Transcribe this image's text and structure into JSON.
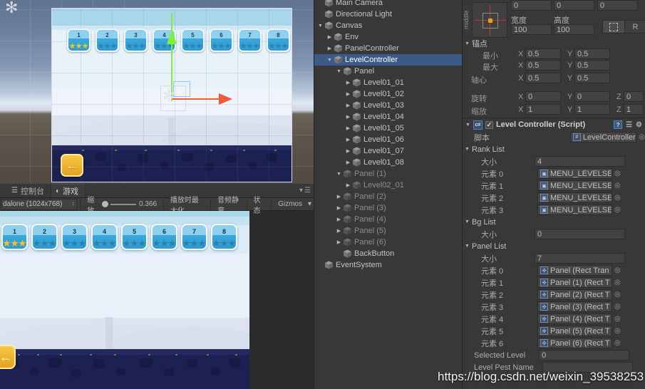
{
  "scene": {
    "levels": [
      {
        "num": "1",
        "stars": [
          "gold",
          "gold",
          "gold"
        ]
      },
      {
        "num": "2",
        "stars": [
          "blue",
          "blue",
          "blue"
        ]
      },
      {
        "num": "3",
        "stars": [
          "blue",
          "blue",
          "blue"
        ]
      },
      {
        "num": "4",
        "stars": [
          "blue",
          "blue",
          "blue"
        ]
      },
      {
        "num": "5",
        "stars": [
          "blue",
          "blue",
          "blue"
        ]
      },
      {
        "num": "6",
        "stars": [
          "blue",
          "blue",
          "blue"
        ]
      },
      {
        "num": "7",
        "stars": [
          "blue",
          "blue",
          "blue"
        ]
      },
      {
        "num": "8",
        "stars": [
          "blue",
          "blue",
          "blue"
        ]
      }
    ],
    "back_button_icon": "left-arrow-icon"
  },
  "game_panel": {
    "tabs": [
      {
        "label": "控制台",
        "icon": "console-icon",
        "active": false
      },
      {
        "label": "游戏",
        "icon": "gamepad-icon",
        "active": true
      }
    ],
    "toolbar": {
      "resolution": "dalone (1024x768)",
      "zoom_label": "缩放",
      "zoom_value": "0.366",
      "maximize_on_play": "播放时最大化",
      "mute_audio": "音频静音",
      "stats": "状态",
      "gizmos": "Gizmos"
    },
    "levels": [
      {
        "num": "1",
        "stars": [
          "gold",
          "gold",
          "gold"
        ]
      },
      {
        "num": "2",
        "stars": [
          "blue",
          "blue",
          "blue"
        ]
      },
      {
        "num": "3",
        "stars": [
          "blue",
          "blue",
          "blue"
        ]
      },
      {
        "num": "4",
        "stars": [
          "blue",
          "blue",
          "blue"
        ]
      },
      {
        "num": "5",
        "stars": [
          "blue",
          "blue",
          "blue"
        ]
      },
      {
        "num": "6",
        "stars": [
          "blue",
          "blue",
          "blue"
        ]
      },
      {
        "num": "7",
        "stars": [
          "blue",
          "blue",
          "blue"
        ]
      },
      {
        "num": "8",
        "stars": [
          "blue",
          "blue",
          "blue"
        ]
      }
    ]
  },
  "hierarchy": {
    "items": [
      {
        "label": "Main Camera",
        "indent": 0,
        "arrow": "",
        "selected": false,
        "dim": false
      },
      {
        "label": "Directional Light",
        "indent": 0,
        "arrow": "",
        "selected": false,
        "dim": false
      },
      {
        "label": "Canvas",
        "indent": 0,
        "arrow": "▼",
        "selected": false,
        "dim": false
      },
      {
        "label": "Env",
        "indent": 1,
        "arrow": "▶",
        "selected": false,
        "dim": false
      },
      {
        "label": "PanelController",
        "indent": 1,
        "arrow": "▶",
        "selected": false,
        "dim": false
      },
      {
        "label": "LevelController",
        "indent": 1,
        "arrow": "▼",
        "selected": true,
        "dim": false
      },
      {
        "label": "Panel",
        "indent": 2,
        "arrow": "▼",
        "selected": false,
        "dim": false
      },
      {
        "label": "Level01_01",
        "indent": 3,
        "arrow": "▶",
        "selected": false,
        "dim": false
      },
      {
        "label": "Level01_02",
        "indent": 3,
        "arrow": "▶",
        "selected": false,
        "dim": false
      },
      {
        "label": "Level01_03",
        "indent": 3,
        "arrow": "▶",
        "selected": false,
        "dim": false
      },
      {
        "label": "Level01_04",
        "indent": 3,
        "arrow": "▶",
        "selected": false,
        "dim": false
      },
      {
        "label": "Level01_05",
        "indent": 3,
        "arrow": "▶",
        "selected": false,
        "dim": false
      },
      {
        "label": "Level01_06",
        "indent": 3,
        "arrow": "▶",
        "selected": false,
        "dim": false
      },
      {
        "label": "Level01_07",
        "indent": 3,
        "arrow": "▶",
        "selected": false,
        "dim": false
      },
      {
        "label": "Level01_08",
        "indent": 3,
        "arrow": "▶",
        "selected": false,
        "dim": false
      },
      {
        "label": "Panel (1)",
        "indent": 2,
        "arrow": "▼",
        "selected": false,
        "dim": true
      },
      {
        "label": "Level02_01",
        "indent": 3,
        "arrow": "▶",
        "selected": false,
        "dim": true
      },
      {
        "label": "Panel (2)",
        "indent": 2,
        "arrow": "▶",
        "selected": false,
        "dim": true
      },
      {
        "label": "Panel (3)",
        "indent": 2,
        "arrow": "▶",
        "selected": false,
        "dim": true
      },
      {
        "label": "Panel (4)",
        "indent": 2,
        "arrow": "▶",
        "selected": false,
        "dim": true
      },
      {
        "label": "Panel (5)",
        "indent": 2,
        "arrow": "▶",
        "selected": false,
        "dim": true
      },
      {
        "label": "Panel (6)",
        "indent": 2,
        "arrow": "▶",
        "selected": false,
        "dim": true
      },
      {
        "label": "BackButton",
        "indent": 2,
        "arrow": "",
        "selected": false,
        "dim": false
      },
      {
        "label": "EventSystem",
        "indent": 0,
        "arrow": "",
        "selected": false,
        "dim": false
      }
    ]
  },
  "inspector": {
    "rect_transform": {
      "anchor_preset_label": "middle",
      "pos_z": "0",
      "top_row": [
        "0",
        "0",
        "0"
      ],
      "width_label": "宽度",
      "height_label": "高度",
      "width_value": "100",
      "height_value": "100",
      "blueprint_icon": "blueprint-icon",
      "raw_button": "R",
      "anchors_label": "锚点",
      "min_label": "最小",
      "max_label": "最大",
      "pivot_label": "轴心",
      "rotation_label": "旋转",
      "scale_label": "缩放",
      "axis_x": "X",
      "axis_y": "Y",
      "axis_z": "Z",
      "min_x": "0.5",
      "min_y": "0.5",
      "max_x": "0.5",
      "max_y": "0.5",
      "pivot_x": "0.5",
      "pivot_y": "0.5",
      "rot_x": "0",
      "rot_y": "0",
      "rot_z": "0",
      "scale_x": "1",
      "scale_y": "1",
      "scale_z": "1"
    },
    "component": {
      "title": "Level Controller  (Script)",
      "enabled": true,
      "script_label": "脚本",
      "script_value": "LevelController",
      "rank_list": {
        "title": "Rank List",
        "size_label": "大小",
        "size_value": "4",
        "elements": [
          {
            "label": "元素 0",
            "value": "MENU_LEVELSEL"
          },
          {
            "label": "元素 1",
            "value": "MENU_LEVELSEL"
          },
          {
            "label": "元素 2",
            "value": "MENU_LEVELSEL"
          },
          {
            "label": "元素 3",
            "value": "MENU_LEVELSEL"
          }
        ]
      },
      "bg_list": {
        "title": "Bg List",
        "size_label": "大小",
        "size_value": "0"
      },
      "panel_list": {
        "title": "Panel List",
        "size_label": "大小",
        "size_value": "7",
        "elements": [
          {
            "label": "元素 0",
            "value": "Panel (Rect Tran"
          },
          {
            "label": "元素 1",
            "value": "Panel (1) (Rect T"
          },
          {
            "label": "元素 2",
            "value": "Panel (2) (Rect T"
          },
          {
            "label": "元素 3",
            "value": "Panel (3) (Rect T"
          },
          {
            "label": "元素 4",
            "value": "Panel (4) (Rect T"
          },
          {
            "label": "元素 5",
            "value": "Panel (5) (Rect T"
          },
          {
            "label": "元素 6",
            "value": "Panel (6) (Rect T"
          }
        ]
      },
      "selected_level_label": "Selected Level",
      "selected_level_value": "0",
      "level_rest_name_label": "Level Pest Name"
    }
  },
  "watermark": "https://blog.csdn.net/weixin_39538253"
}
